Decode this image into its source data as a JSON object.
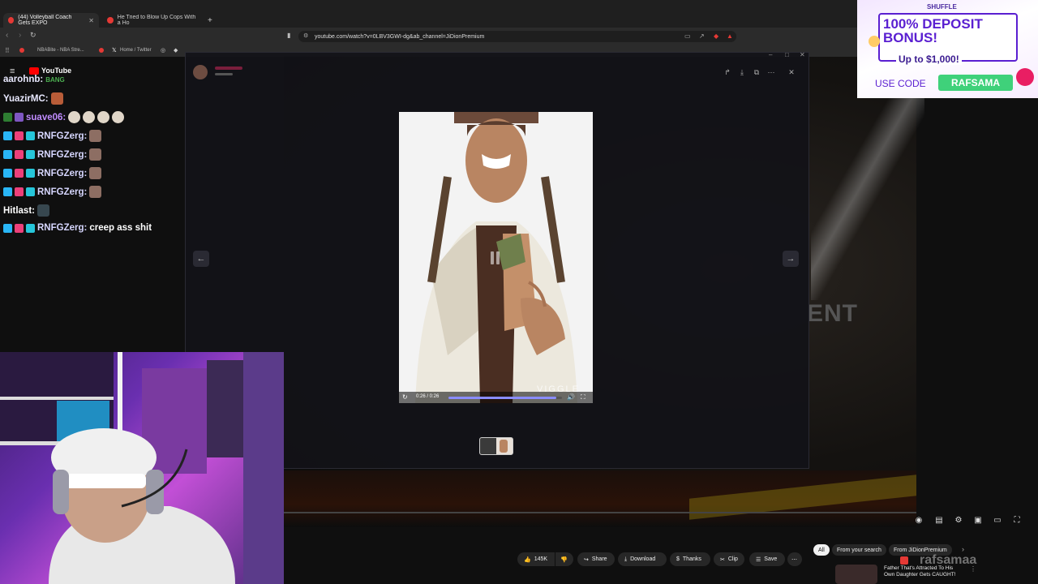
{
  "browser": {
    "tabs": [
      {
        "label": "(44) Volleyball Coach Gets EXPO",
        "active": true
      },
      {
        "label": "He Tried to Blow Up Cops With a Ho",
        "active": false
      }
    ],
    "new_tab": "+",
    "url": "youtube.com/watch?v=0LBV3GWI-dg&ab_channel=JiDionPremium",
    "bookmarks": [
      "NBABite - NBA Stre...",
      "Home / Twitter"
    ]
  },
  "chat": {
    "platform_label": "YouTube",
    "messages": [
      {
        "user": "aarohnb:",
        "text": "",
        "color": "#e9e9ff"
      },
      {
        "user": "YuazirMC:",
        "text": "",
        "color": "#e9e9ff"
      },
      {
        "user": "suave06:",
        "text": "",
        "color": "#c08cff"
      },
      {
        "user": "RNFGZerg:",
        "text": "",
        "color": "#d7d7ff"
      },
      {
        "user": "RNFGZerg:",
        "text": "",
        "color": "#d7d7ff"
      },
      {
        "user": "RNFGZerg:",
        "text": "",
        "color": "#d7d7ff"
      },
      {
        "user": "RNFGZerg:",
        "text": "",
        "color": "#d7d7ff"
      },
      {
        "user": "Hitlast:",
        "text": "",
        "color": "#ffffff"
      },
      {
        "user": "RNFGZerg:",
        "text": "creep ass shit",
        "color": "#d7d7ff"
      }
    ]
  },
  "modal": {
    "media": {
      "time": "0:26 / 0:26",
      "progress": 0.95,
      "watermark": "VIGGLE",
      "play_state": "pause-icon"
    }
  },
  "ad": {
    "brand": "SHUFFLE",
    "headline": "100% DEPOSIT BONUS!",
    "subline": "Up to $1,000!",
    "cta_label": "USE CODE",
    "code": "RAFSAMA"
  },
  "video": {
    "overlay_text": "ENT",
    "watermark": "rafsamaa"
  },
  "actions": {
    "likes": "145K",
    "share": "Share",
    "download": "Download",
    "thanks": "Thanks",
    "clip": "Clip",
    "save": "Save",
    "more": "⋯"
  },
  "chips": {
    "all": "All",
    "from_search": "From your search",
    "from_channel": "From JiDionPremium"
  },
  "recommendation": {
    "title": "Father That's Attracted To His Own Daughter Gets CAUGHT!"
  },
  "colors": {
    "accent_red": "#ff0033",
    "progress": "#8a8cff",
    "ad_purple": "#5a1fd1",
    "ad_green": "#3fd17a"
  }
}
